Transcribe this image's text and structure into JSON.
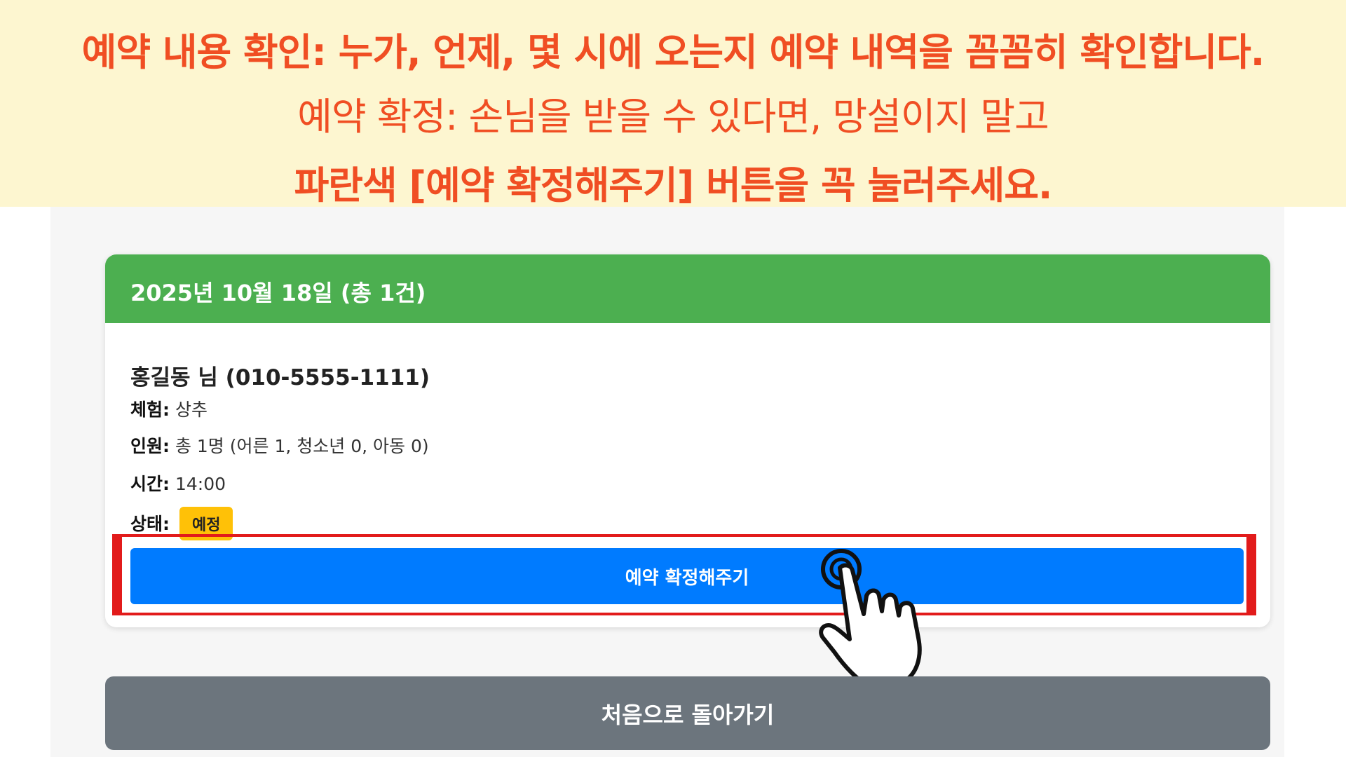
{
  "banner": {
    "line1": "예약 내용 확인: 누가, 언제, 몇 시에 오는지 예약 내역을 꼼꼼히 확인합니다.",
    "line2": "예약 확정: 손님을 받을 수 있다면, 망설이지 말고",
    "line3": "파란색 [예약 확정해주기] 버튼을 꼭 눌러주세요."
  },
  "card": {
    "header_title": "2025년 10월 18일 (총 1건)",
    "guest": "홍길동 님 (010-5555-1111)",
    "experience_label": "체험:",
    "experience_value": "상추",
    "people_label": "인원:",
    "people_value": "총 1명 (어른 1, 청소년 0, 아동 0)",
    "time_label": "시간:",
    "time_value": "14:00",
    "status_label": "상태:",
    "status_value": "예정",
    "confirm_button": "예약 확정해주기"
  },
  "back_button": "처음으로 돌아가기",
  "colors": {
    "banner_bg": "#fdf6d0",
    "banner_text": "#f04e23",
    "header_green": "#4caf50",
    "confirm_blue": "#007bff",
    "back_gray": "#6c757d",
    "badge_yellow": "#ffc107",
    "highlight_red": "#e21b1b"
  },
  "icons": {
    "pointer": "pointing-hand-icon"
  }
}
